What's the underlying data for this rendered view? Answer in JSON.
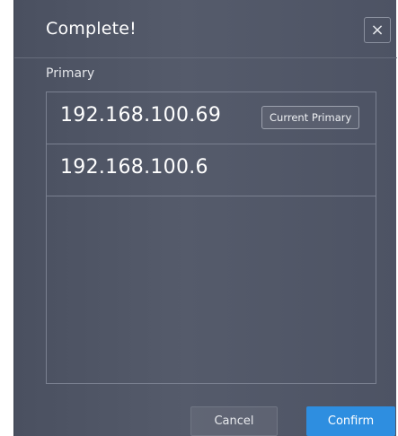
{
  "dialog": {
    "title": "Complete!",
    "close_icon": "×",
    "section_label": "Primary",
    "items": [
      {
        "ip": "192.168.100.69",
        "badge": "Current Primary"
      },
      {
        "ip": "192.168.100.6"
      }
    ],
    "cancel_label": "Cancel",
    "confirm_label": "Confirm"
  },
  "colors": {
    "accent": "#2e8ee0",
    "background": "#50566a",
    "border": "#7a8090"
  }
}
